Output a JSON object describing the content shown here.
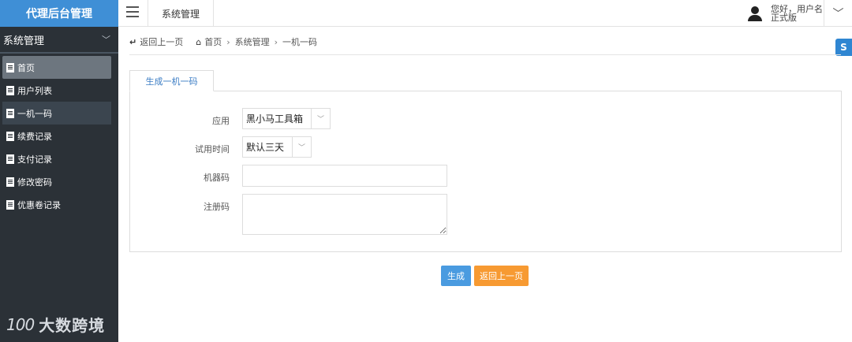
{
  "sidebar": {
    "brand": "代理后台管理",
    "section": "系统管理",
    "items": [
      {
        "label": "首页"
      },
      {
        "label": "用户列表"
      },
      {
        "label": "一机一码"
      },
      {
        "label": "续费记录"
      },
      {
        "label": "支付记录"
      },
      {
        "label": "修改密码"
      },
      {
        "label": "优惠卷记录"
      }
    ],
    "watermark_text": "大数跨境",
    "watermark_logo": "100"
  },
  "topbar": {
    "tab": "系统管理",
    "greeting": "您好，用户名",
    "edition": "正式版"
  },
  "breadcrumb": {
    "back": "返回上一页",
    "home": "首页",
    "section": "系统管理",
    "current": "一机一码"
  },
  "form": {
    "tab": "生成一机一码",
    "app_label": "应用",
    "app_value": "黑小马工具箱",
    "trial_label": "试用时间",
    "trial_value": "默认三天",
    "machine_label": "机器码",
    "machine_value": "",
    "reg_label": "注册码",
    "reg_value": ""
  },
  "actions": {
    "generate": "生成",
    "back": "返回上一页"
  },
  "colors": {
    "sidebar_bg": "#2b3137",
    "brand_bg": "#3f8fd6",
    "primary": "#4a9be0",
    "warning": "#f79a32"
  }
}
